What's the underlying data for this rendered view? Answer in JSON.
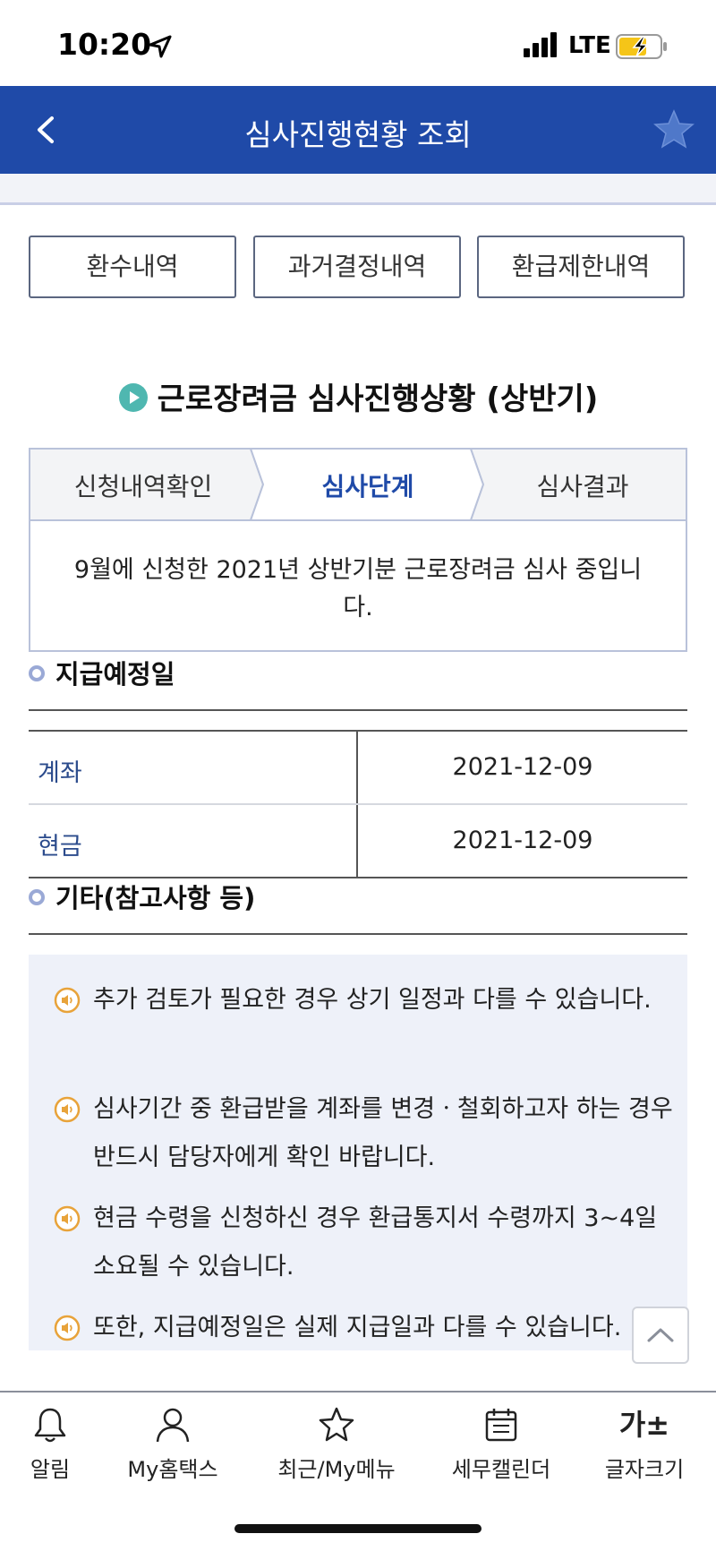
{
  "status_bar": {
    "time": "10:20",
    "network": "LTE"
  },
  "header": {
    "title": "심사진행현황 조회"
  },
  "top_buttons": [
    "환수내역",
    "과거결정내역",
    "환급제한내역"
  ],
  "main_title": "근로장려금 심사진행상황 (상반기)",
  "steps": [
    {
      "label": "신청내역확인",
      "active": false
    },
    {
      "label": "심사단계",
      "active": true
    },
    {
      "label": "심사결과",
      "active": false
    }
  ],
  "notice": "9월에 신청한 2021년 상반기분 근로장려금 심사 중입니다.",
  "payment_section": {
    "title": "지급예정일",
    "rows": [
      {
        "label": "계좌",
        "value": "2021-12-09"
      },
      {
        "label": "현금",
        "value": "2021-12-09"
      }
    ]
  },
  "notes_section": {
    "title": "기타(참고사항 등)",
    "items": [
      "추가 검토가 필요한 경우 상기 일정과 다를 수 있습니다.",
      "심사기간 중 환급받을 계좌를 변경ㆍ철회하고자 하는 경우 반드시 담당자에게 확인 바랍니다.",
      "현금 수령을 신청하신 경우 환급통지서 수령까지 3~4일 소요될 수 있습니다.",
      "또한, 지급예정일은 실제 지급일과 다를 수 있습니다."
    ]
  },
  "bottom_nav": [
    {
      "label": "알림",
      "icon": "bell-icon"
    },
    {
      "label": "My홈택스",
      "icon": "person-icon"
    },
    {
      "label": "최근/My메뉴",
      "icon": "star-icon"
    },
    {
      "label": "세무캘린더",
      "icon": "calendar-icon"
    },
    {
      "label": "글자크기",
      "icon": "font-size-icon",
      "glyph": "가±"
    }
  ],
  "colors": {
    "header": "#1f4aa8",
    "active_step": "#1f4aa8",
    "note_icon": "#e8a33a",
    "title_icon": "#4fb7b0"
  }
}
